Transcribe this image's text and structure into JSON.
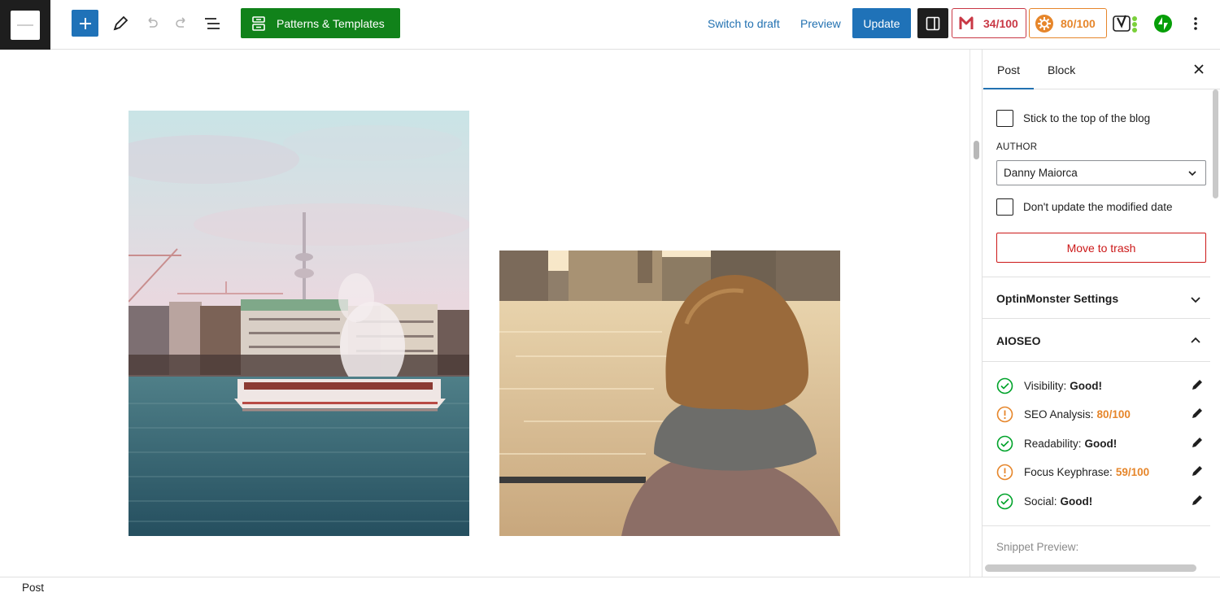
{
  "toolbar": {
    "patterns_label": "Patterns & Templates",
    "switch_to_draft_label": "Switch to draft",
    "preview_label": "Preview",
    "update_label": "Update",
    "score_primary": "34/100",
    "score_secondary": "80/100",
    "icons": [
      "site-icon",
      "plus-icon",
      "pencil-tool-icon",
      "undo-icon",
      "redo-icon",
      "list-view-icon",
      "patterns-icon",
      "sidebar-toggle-icon",
      "score-flag-icon",
      "aioseo-icon",
      "yoast-icon",
      "jetpack-bolt-icon",
      "more-options-icon"
    ],
    "colors": {
      "primary_blue": "#1f72b8",
      "patterns_green": "#11821a",
      "score_red": "#c93845",
      "score_orange": "#e6862b"
    }
  },
  "canvas": {
    "images": [
      {
        "name": "city-waterfront-photo"
      },
      {
        "name": "girl-at-lake-photo"
      }
    ]
  },
  "sidebar": {
    "tabs": [
      {
        "label": "Post",
        "active": true
      },
      {
        "label": "Block",
        "active": false
      }
    ],
    "sticky_label": "Stick to the top of the blog",
    "author_label": "AUTHOR",
    "author_value": "Danny Maiorca",
    "modified_label": "Don't update the modified date",
    "trash_label": "Move to trash",
    "optinmonster_title": "OptinMonster Settings",
    "aioseo_title": "AIOSEO",
    "aioseo_rows": [
      {
        "label": "Visibility:",
        "value": "Good!",
        "status": "good"
      },
      {
        "label": "SEO Analysis:",
        "value": "80/100",
        "status": "warn"
      },
      {
        "label": "Readability:",
        "value": "Good!",
        "status": "good"
      },
      {
        "label": "Focus Keyphrase:",
        "value": "59/100",
        "status": "warn"
      },
      {
        "label": "Social:",
        "value": "Good!",
        "status": "good"
      }
    ],
    "snippet_label": "Snippet Preview:"
  },
  "footer": {
    "breadcrumb": "Post"
  }
}
